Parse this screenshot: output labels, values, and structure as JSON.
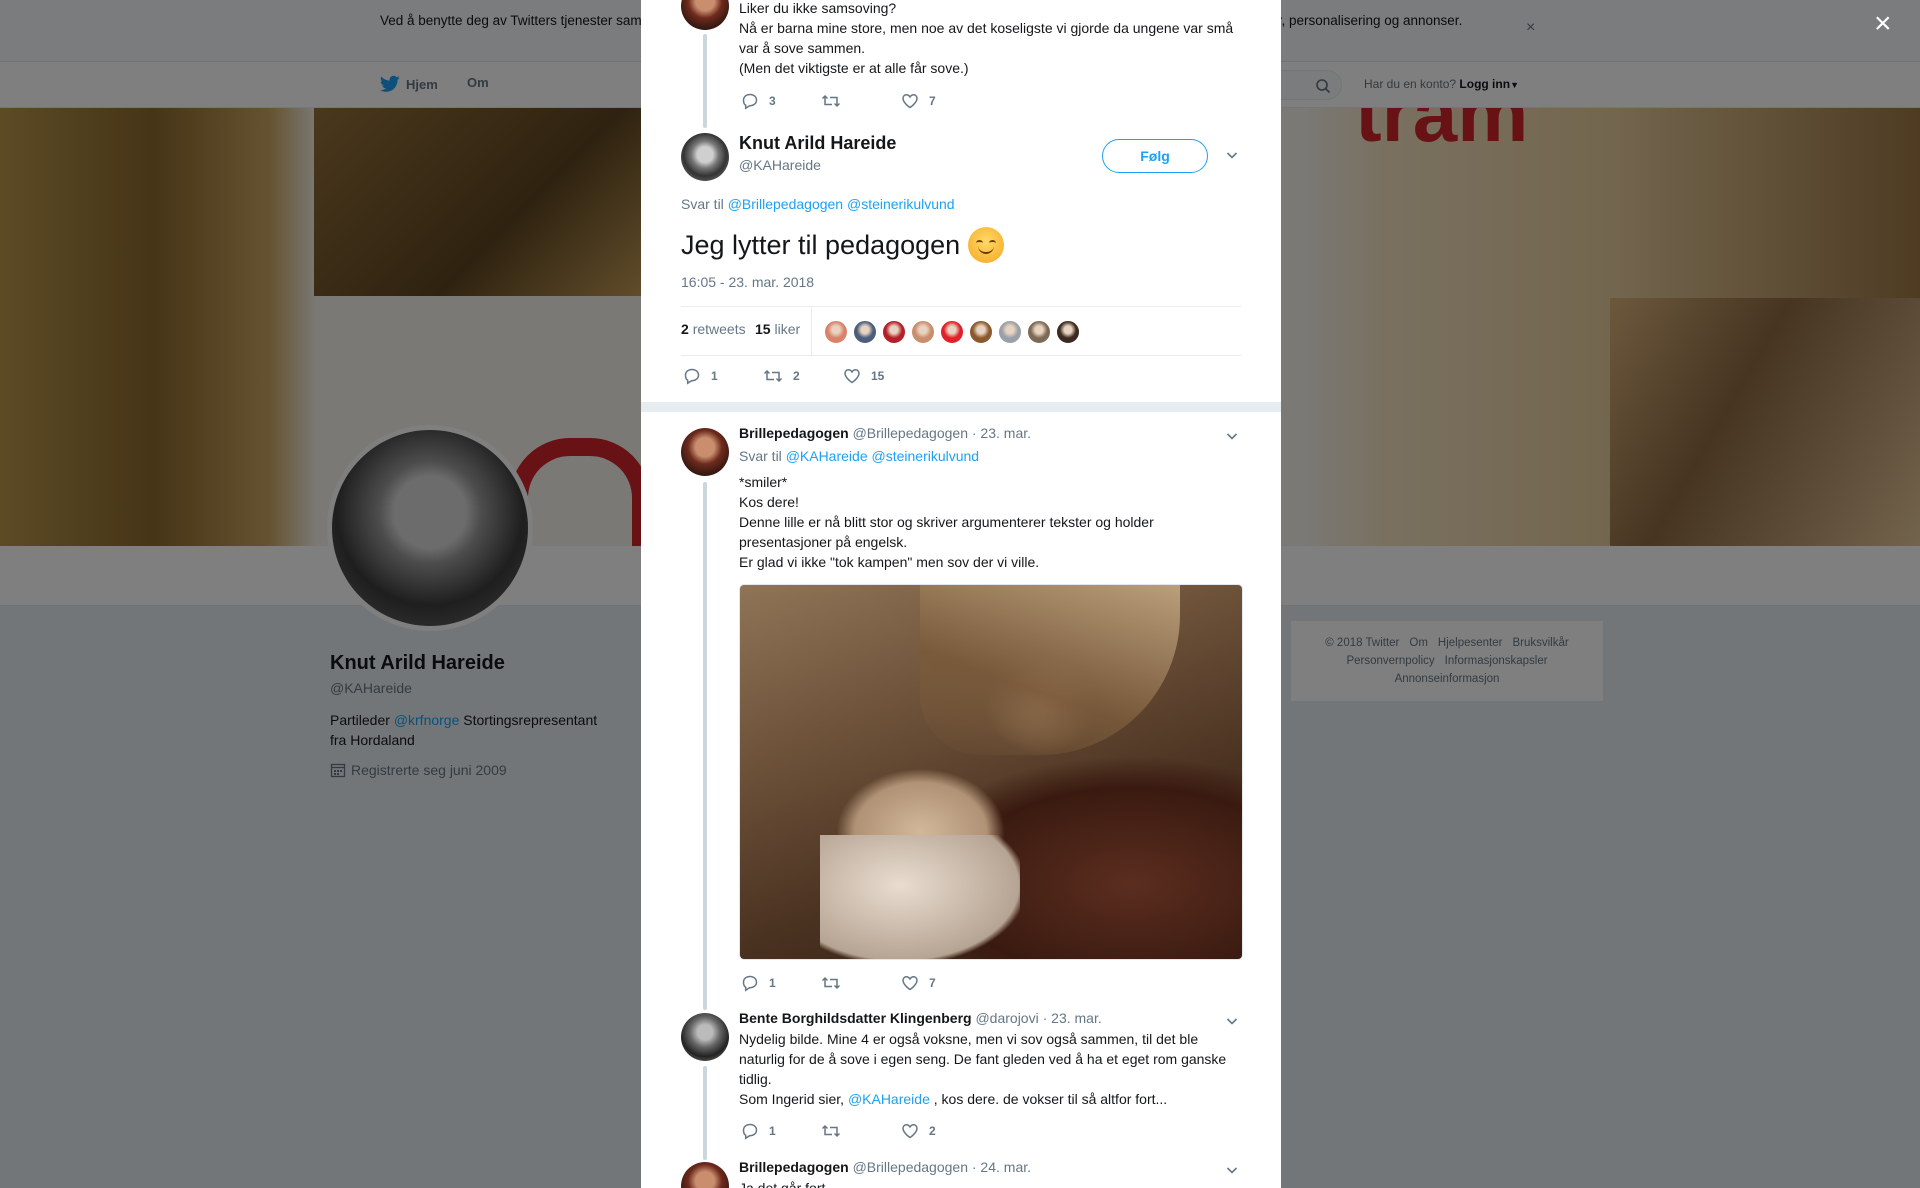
{
  "cookie_bar": {
    "text": "Ved å benytte deg av Twitters tjenester samtykker du i vår bruk av informasjonskapsler. Vi og våre partnere bruker informasjonskapsler til bl.a. analyser, personalisering og annonser.",
    "close": "×"
  },
  "nav": {
    "home": "Hjem",
    "about": "Om",
    "account_prompt": "Har du en konto?",
    "login": "Logg inn"
  },
  "profile": {
    "name": "Knut Arild Hareide",
    "handle": "@KAHareide",
    "bio_prefix": "Partileder ",
    "bio_link": "@krfnorge",
    "bio_suffix": " Stortingsrepresentant fra Hordaland",
    "joined": "Registrerte seg juni 2009"
  },
  "footer": {
    "links": [
      "© 2018 Twitter",
      "Om",
      "Hjelpesenter",
      "Bruksvilkår",
      "Personvernpolicy",
      "Informasjonskapsler",
      "Annonseinformasjon"
    ]
  },
  "overlay_close": "×",
  "parent_tweet": {
    "lines": [
      "Liker du ikke samsoving?",
      "Nå er barna mine store, men noe av det koseligste vi gjorde da ungene var små var å sove sammen.",
      "(Men det viktigste er at alle får sove.)"
    ],
    "replies": "3",
    "retweets": "",
    "likes": "7"
  },
  "main_tweet": {
    "name": "Knut Arild Hareide",
    "handle": "@KAHareide",
    "follow": "Følg",
    "reply_to_prefix": "Svar til ",
    "reply_to_1": "@Brillepedagogen",
    "reply_to_2": "@steinerikulvund",
    "text": "Jeg lytter til pedagogen",
    "emoji": "smiling-face-icon",
    "timestamp": "16:05 - 23. mar. 2018",
    "retweet_count": "2",
    "retweet_label": "retweets",
    "like_count": "15",
    "like_label": "liker",
    "replies": "1",
    "retweets": "2",
    "likes": "15",
    "liker_colors": [
      "#d9826a",
      "#4b5e7a",
      "#b3202a",
      "#c98e6e",
      "#e0202a",
      "#8a5a2e",
      "#9aa0a8",
      "#7d6a55",
      "#3b2a1f"
    ]
  },
  "replies": [
    {
      "name": "Brillepedagogen",
      "handle": "@Brillepedagogen",
      "date": "· 23. mar.",
      "reply_to_prefix": "Svar til ",
      "reply_to_1": "@KAHareide",
      "reply_to_2": "@steinerikulvund",
      "lines": [
        "*smiler*",
        "Kos dere!",
        "Denne lille er nå blitt stor og skriver argumenterer tekster og holder presentasjoner på engelsk.",
        "Er glad vi ikke \"tok kampen\" men sov der vi ville."
      ],
      "replies": "1",
      "retweets": "",
      "likes": "7"
    },
    {
      "name": "Bente Borghildsdatter Klingenberg",
      "handle": "@darojovi",
      "date": "· 23. mar.",
      "text": "Nydelig bilde. Mine 4 er også voksne, men vi sov også sammen, til det ble naturlig for de å sove i egen seng.  De fant gleden ved å ha et eget rom ganske tidlig.",
      "text2_prefix": "Som Ingerid sier, ",
      "text2_link": "@KAHareide",
      "text2_suffix": " , kos dere. de vokser til så altfor fort...",
      "replies": "1",
      "retweets": "",
      "likes": "2"
    },
    {
      "name": "Brillepedagogen",
      "handle": "@Brillepedagogen",
      "date": "· 24. mar.",
      "text": "Ja det går fort"
    }
  ]
}
